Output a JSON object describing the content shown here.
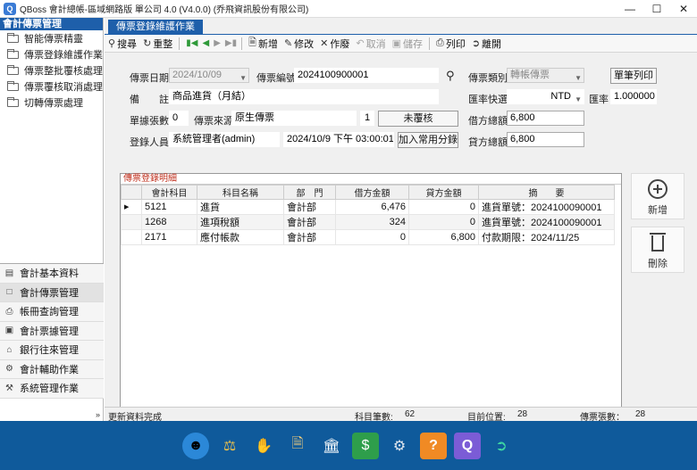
{
  "window": {
    "title": "QBoss 會計總帳-區域網路版 單公司 4.0 (V4.0.0) (乔飛資訊股份有限公司)",
    "min": "—",
    "max": "☐",
    "close": "✕"
  },
  "sidebar": {
    "header": "會計傳票管理",
    "items": [
      {
        "label": "智能傳票精靈"
      },
      {
        "label": "傳票登錄維護作業"
      },
      {
        "label": "傳票整批覆核處理"
      },
      {
        "label": "傳票覆核取消處理"
      },
      {
        "label": "切轉傳票處理"
      }
    ],
    "bottom": [
      {
        "label": "會計基本資料",
        "icon": "▤"
      },
      {
        "label": "會計傳票管理",
        "icon": "□"
      },
      {
        "label": "帳冊查詢管理",
        "icon": "⎙"
      },
      {
        "label": "會計票據管理",
        "icon": "▣"
      },
      {
        "label": "銀行往來管理",
        "icon": "⌂"
      },
      {
        "label": "會計輔助作業",
        "icon": "⚙"
      },
      {
        "label": "系統管理作業",
        "icon": "⚒"
      }
    ],
    "chevron": "»"
  },
  "tab": {
    "label": "傳票登錄維護作業"
  },
  "toolbar": {
    "search": "搜尋",
    "reload": "重整",
    "add": "新增",
    "edit": "修改",
    "void": "作廢",
    "cancel": "取消",
    "save": "儲存",
    "print": "列印",
    "exit": "離開"
  },
  "form": {
    "date_label": "傳票日期",
    "date_value": "2024/10/09",
    "no_label": "傳票編號",
    "no_value": "2024100900001",
    "type_label": "傳票類別",
    "type_value": "轉帳傳票",
    "print_button": "單筆列印",
    "note_label": "備　　註",
    "note_value": "商品進貨（月結）",
    "fx_label": "匯率快選",
    "fx_value": "NTD",
    "rate_label": "匯率",
    "rate_value": "1.000000",
    "attach_label": "單據張數",
    "attach_value": "0",
    "source_label": "傳票來源",
    "source_value": "原生傳票",
    "count_value": "1",
    "review_button": "未覆核",
    "debit_label": "借方總額",
    "debit_value": "6,800",
    "user_label": "登錄人員",
    "user_value": "系統管理者(admin)",
    "time_value": "2024/10/9 下午 03:00:01",
    "summary_button": "加入常用分錄",
    "credit_label": "貸方總額",
    "credit_value": "6,800"
  },
  "grid": {
    "title": "傳票登錄明細",
    "columns": [
      "會計科目",
      "科目名稱",
      "部　門",
      "借方金額",
      "貸方金額",
      "摘　　要"
    ],
    "rows": [
      {
        "code": "5121",
        "name": "進貨",
        "dept": "會計部",
        "debit": "6,476",
        "credit": "0",
        "memo": "進貨單號：2024100090001"
      },
      {
        "code": "1268",
        "name": "進項稅額",
        "dept": "會計部",
        "debit": "324",
        "credit": "0",
        "memo": "進貨單號：2024100090001"
      },
      {
        "code": "2171",
        "name": "應付帳款",
        "dept": "會計部",
        "debit": "0",
        "credit": "6,800",
        "memo": "付款期限：2024/11/25"
      }
    ]
  },
  "side_buttons": {
    "add": "新增",
    "delete": "刪除"
  },
  "status": {
    "message": "更新資料完成",
    "count_label": "科目筆數:",
    "count_value": "62",
    "pos_label": "目前位置:",
    "pos_value": "28",
    "vouchers_label": "傳票張數：",
    "vouchers_value": "28"
  },
  "taskbar": {
    "icons": [
      "mascot-icon",
      "scales-icon",
      "handshake-icon",
      "document-icon",
      "bank-icon",
      "money-icon",
      "settings-icon",
      "help-icon",
      "q-icon",
      "exit-icon"
    ]
  }
}
